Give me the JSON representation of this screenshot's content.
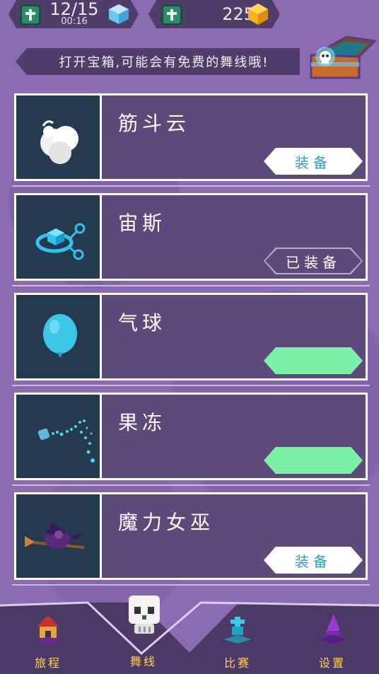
{
  "status": {
    "lives": "12/15",
    "lives_timer": "00:16",
    "coins": "225"
  },
  "banner": {
    "text": "打开宝箱,可能会有免费的舞线哦!"
  },
  "trails": [
    {
      "name": "筋斗云",
      "icon": "cloud-icon",
      "button": "装备",
      "state": "equip"
    },
    {
      "name": "宙斯",
      "icon": "zeus-cube-icon",
      "button": "已装备",
      "state": "equipped"
    },
    {
      "name": "气球",
      "icon": "balloon-icon",
      "button": "",
      "state": "buy"
    },
    {
      "name": "果冻",
      "icon": "jelly-splash-icon",
      "button": "",
      "state": "buy"
    },
    {
      "name": "魔力女巫",
      "icon": "witch-icon",
      "button": "装备",
      "state": "equip"
    }
  ],
  "nav": {
    "journey": "旅程",
    "dance_line": "舞线",
    "match": "比赛",
    "settings": "设置"
  },
  "colors": {
    "background": "#8c6bb3",
    "panel": "#5b4a7a",
    "thumb": "#243b4f",
    "accent_blue": "#2aa0c4",
    "buy_green": "#7df0a8",
    "nav_label": "#ffd055"
  }
}
